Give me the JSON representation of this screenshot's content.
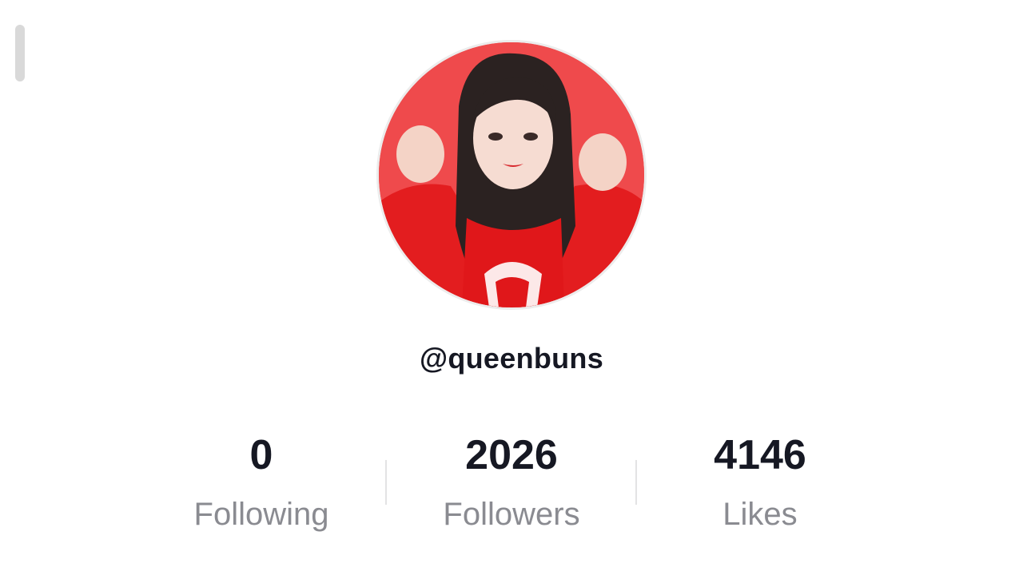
{
  "profile": {
    "username": "@queenbuns",
    "avatar_icon": "profile-photo"
  },
  "stats": [
    {
      "value": "0",
      "label": "Following"
    },
    {
      "value": "2026",
      "label": "Followers"
    },
    {
      "value": "4146",
      "label": "Likes"
    }
  ],
  "colors": {
    "avatar_background": "#ef4a4c",
    "text_primary": "#161823",
    "text_secondary": "#8a8b91"
  }
}
